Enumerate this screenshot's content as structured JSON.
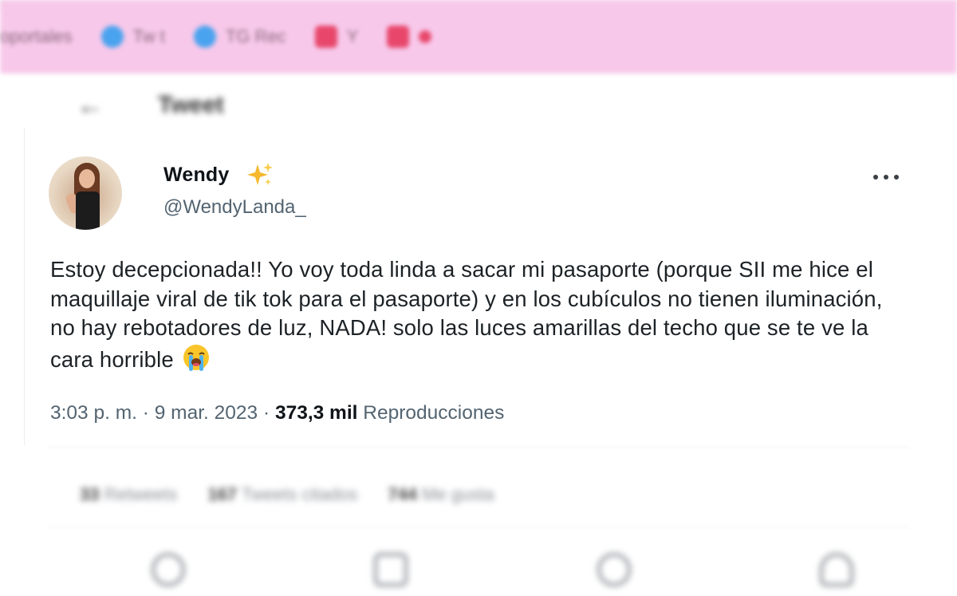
{
  "browser": {
    "bookmarks": [
      {
        "label": "oportales",
        "icon": "none-icon"
      },
      {
        "label": "Tw t",
        "icon": "twitter-icon",
        "color": "#4aa3ef"
      },
      {
        "label": "TG Rec",
        "icon": "circle-icon",
        "color": "#4aa3ef"
      },
      {
        "label": "Y",
        "icon": "mail-icon",
        "color": "#e8476b"
      },
      {
        "label": "",
        "icon": "mail-icon",
        "color": "#e8476b"
      }
    ]
  },
  "page_header": {
    "back_icon": "back-arrow-icon",
    "title": "Tweet"
  },
  "tweet": {
    "author": {
      "display_name": "Wendy",
      "name_emoji": "sparkles-icon",
      "handle": "@WendyLanda_"
    },
    "text": "Estoy decepcionada!! Yo voy toda linda a sacar mi pasaporte (porque SII me hice el maquillaje viral de tik tok para el pasaporte) y en los cubículos no tienen iluminación, no hay rebotadores de luz, NADA! solo las luces amarillas del techo que se te ve la cara horrible",
    "text_emoji": "loudly-crying-face-icon",
    "time": "3:03 p. m.",
    "separator": "·",
    "date": "9 mar. 2023",
    "views_count": "373,3 mil",
    "views_label": "Reproducciones"
  },
  "stats": [
    {
      "count": "33",
      "label": "Retweets"
    },
    {
      "count": "167",
      "label": "Tweets citados"
    },
    {
      "count": "744",
      "label": "Me gusta"
    }
  ],
  "actions": [
    "reply-icon",
    "retweet-icon",
    "like-icon",
    "share-icon"
  ],
  "colors": {
    "bookmarks_bar": "#f7c8ea",
    "secondary_text": "#536471",
    "primary_text": "#0f1419"
  }
}
